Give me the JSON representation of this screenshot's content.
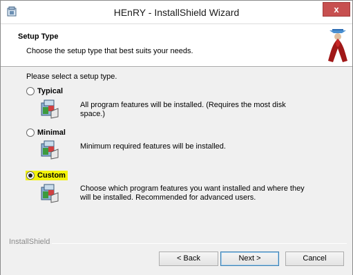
{
  "window": {
    "title": "HEnRY - InstallShield Wizard",
    "close_label": "x"
  },
  "header": {
    "title": "Setup Type",
    "subtitle": "Choose the setup type that best suits your needs."
  },
  "body": {
    "prompt": "Please select a setup type.",
    "options": [
      {
        "label": "Typical",
        "selected": false,
        "description_lines": [
          "All program features will be installed. (Requires the most disk",
          "space.)"
        ]
      },
      {
        "label": "Minimal",
        "selected": false,
        "description_lines": [
          "Minimum required features will be installed."
        ]
      },
      {
        "label": "Custom",
        "selected": true,
        "description_lines": [
          "Choose which program features you want installed and where they",
          "will be installed. Recommended for advanced users."
        ]
      }
    ]
  },
  "footer": {
    "brand": "InstallShield",
    "back_label": "< Back",
    "next_label": "Next >",
    "cancel_label": "Cancel"
  },
  "colors": {
    "highlight": "#f2f20a",
    "close_button": "#c75050"
  }
}
